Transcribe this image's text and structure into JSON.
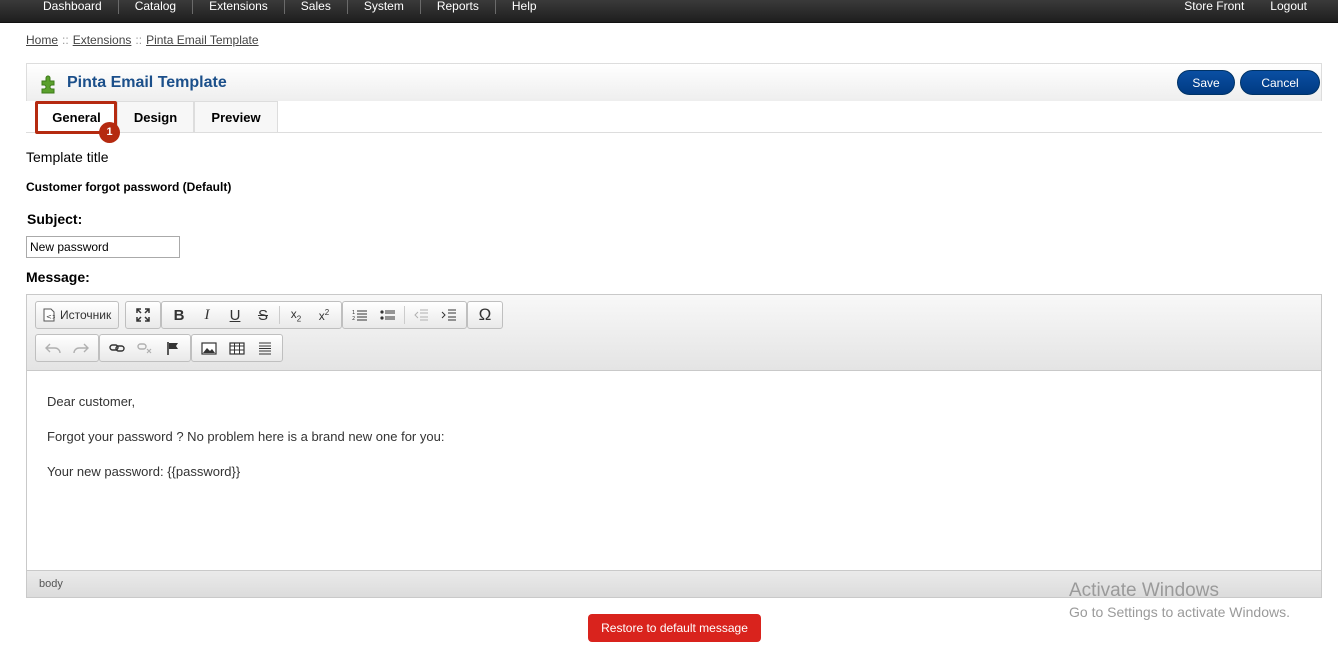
{
  "topnav": {
    "left": [
      "Dashboard",
      "Catalog",
      "Extensions",
      "Sales",
      "System",
      "Reports",
      "Help"
    ],
    "right": [
      "Store Front",
      "Logout"
    ]
  },
  "breadcrumb": {
    "home": "Home",
    "extensions": "Extensions",
    "current": "Pinta Email Template",
    "separator": "::"
  },
  "heading": {
    "title": "Pinta Email Template",
    "save": "Save",
    "cancel": "Cancel"
  },
  "tabs": [
    "General",
    "Design",
    "Preview"
  ],
  "annotation": {
    "step": "1"
  },
  "form": {
    "template_title_label": "Template title",
    "template_title_value": "Customer forgot password (Default)",
    "subject_label": "Subject:",
    "subject_value": "New password",
    "message_label": "Message:"
  },
  "editor": {
    "source_label": "Источник",
    "content": [
      "Dear customer,",
      "Forgot your password ? No problem here is a brand new one for you:",
      "Your new password: {{password}}"
    ],
    "status": "body"
  },
  "restore_button": "Restore to default message",
  "watermark": {
    "title": "Activate Windows",
    "subtitle": "Go to Settings to activate Windows."
  },
  "colors": {
    "accent": "#1b4f8a",
    "button": "#003a82",
    "danger": "#d9231d",
    "highlight": "#b52a10"
  }
}
